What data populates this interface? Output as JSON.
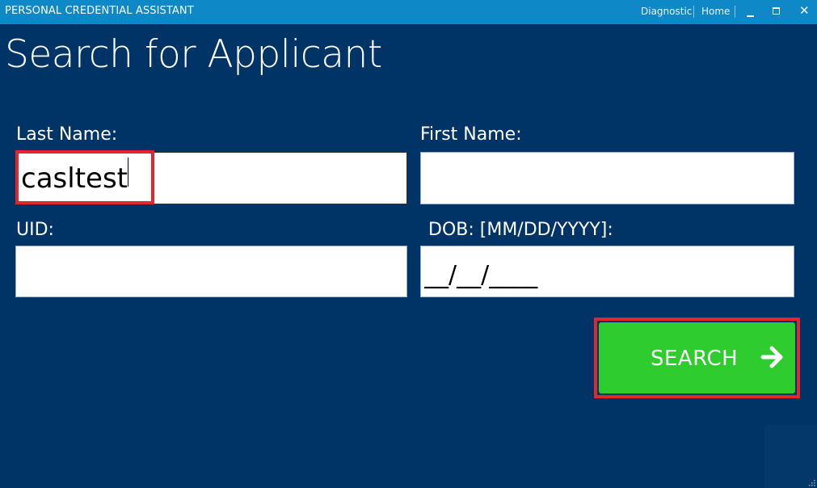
{
  "window": {
    "title": "PERSONAL CREDENTIAL ASSISTANT",
    "links": [
      "Diagnostic",
      "Home"
    ],
    "controls": [
      "minimize-icon",
      "maximize-icon",
      "close-icon"
    ],
    "close_glyph": "✕"
  },
  "page": {
    "title": "Search for Applicant"
  },
  "form": {
    "last_name": {
      "label": "Last Name:",
      "value": "casltest"
    },
    "first_name": {
      "label": "First Name:",
      "value": ""
    },
    "uid": {
      "label": "UID:",
      "value": ""
    },
    "dob": {
      "label": "DOB: [MM/DD/YYYY]:",
      "value": "__/__/____"
    }
  },
  "search_button": {
    "label": "SEARCH",
    "icon": "arrow-right-icon"
  },
  "colors": {
    "background": "#003466",
    "titlebar": "#0f88c7",
    "search_button": "#2ecc2e",
    "highlight": "#e3262d"
  }
}
